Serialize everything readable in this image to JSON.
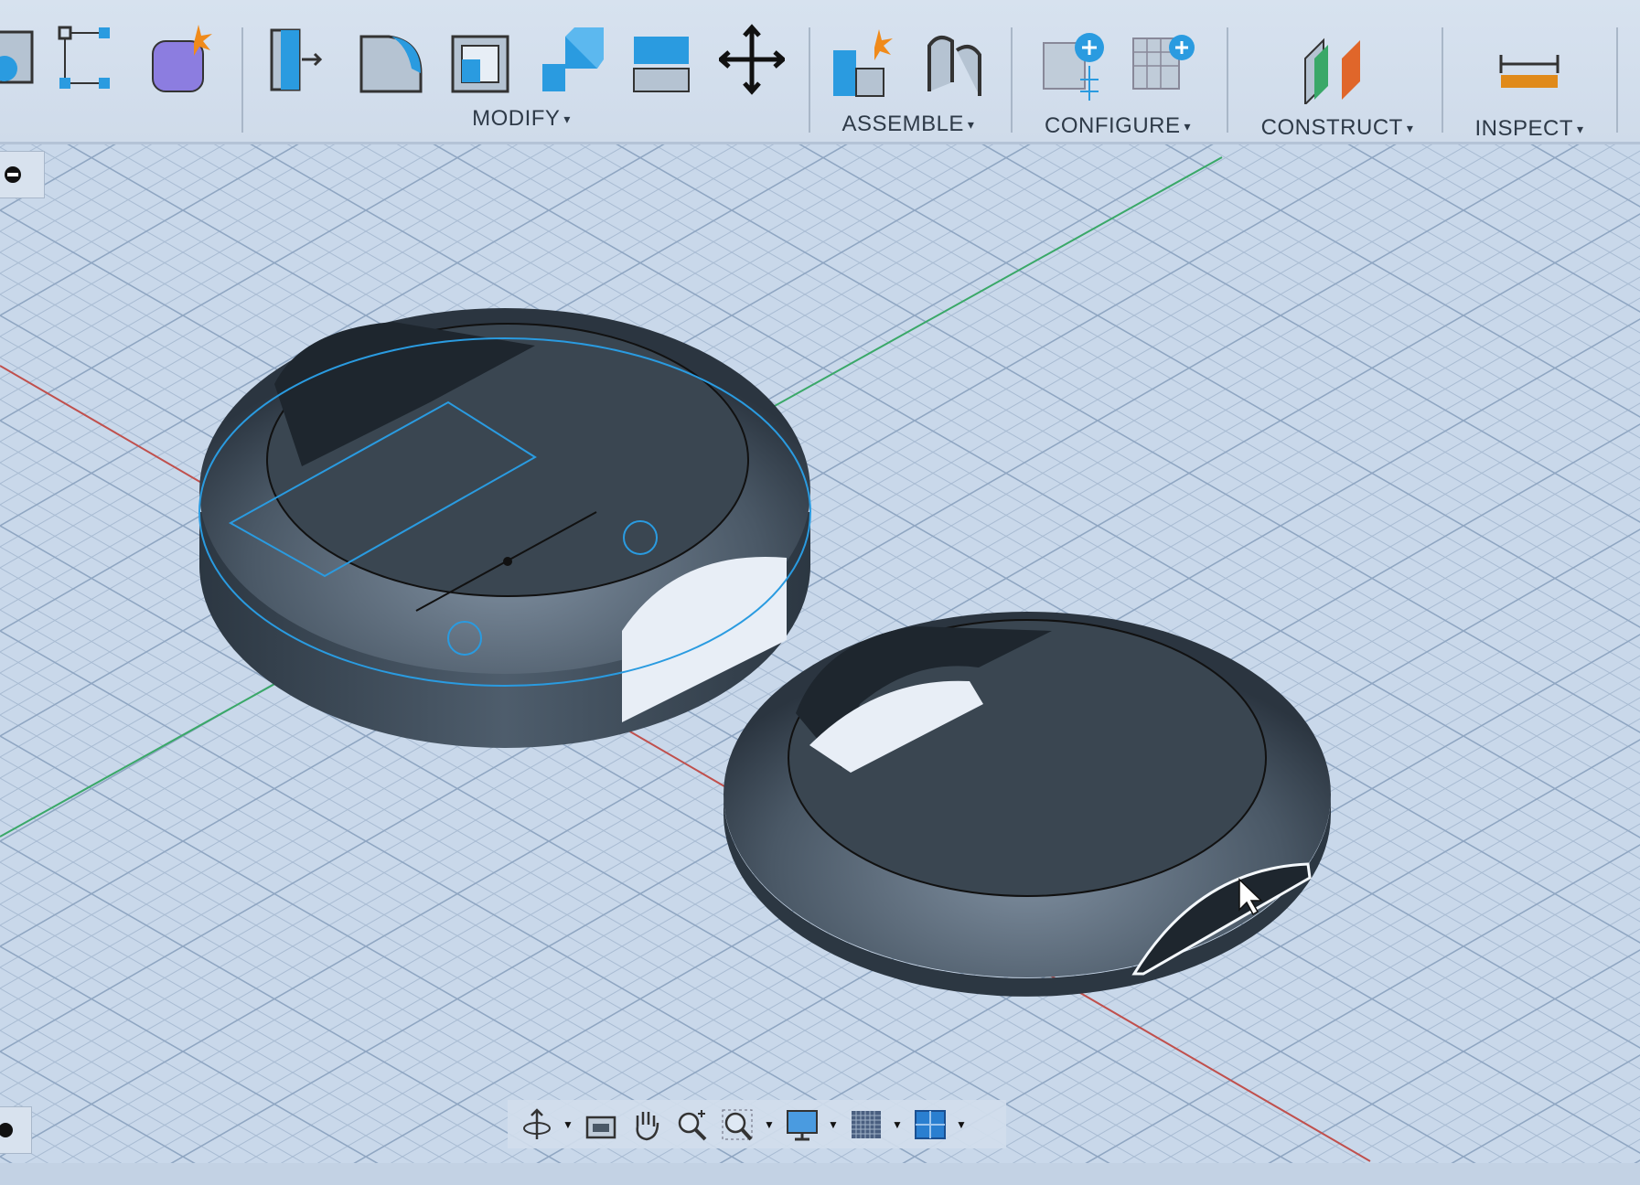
{
  "toolbar": {
    "groups": [
      {
        "label": "MODIFY",
        "caret": "▾"
      },
      {
        "label": "ASSEMBLE",
        "caret": "▾"
      },
      {
        "label": "CONFIGURE",
        "caret": "▾"
      },
      {
        "label": "CONSTRUCT",
        "caret": "▾"
      },
      {
        "label": "INSPECT",
        "caret": "▾"
      }
    ],
    "icons": [
      "component-icon",
      "sketch-constraint-icon",
      "create-form-icon",
      "press-pull-icon",
      "fillet-icon",
      "shell-icon",
      "combine-icon",
      "offset-face-icon",
      "move-icon",
      "new-component-icon",
      "joint-icon",
      "configure-table-icon",
      "configure-grid-icon",
      "construct-plane-icon",
      "measure-icon"
    ]
  },
  "navbar": {
    "icons": [
      "orbit-icon",
      "look-at-icon",
      "pan-hand-icon",
      "zoom-icon",
      "zoom-window-icon",
      "display-settings-icon",
      "grid-settings-icon",
      "viewports-icon"
    ]
  },
  "colors": {
    "viewport_bg": "#c9d8ea",
    "model_body": "#3d4a58",
    "selection": "#2a9be0",
    "x_axis": "#c0504d",
    "y_axis": "#3aa868"
  }
}
